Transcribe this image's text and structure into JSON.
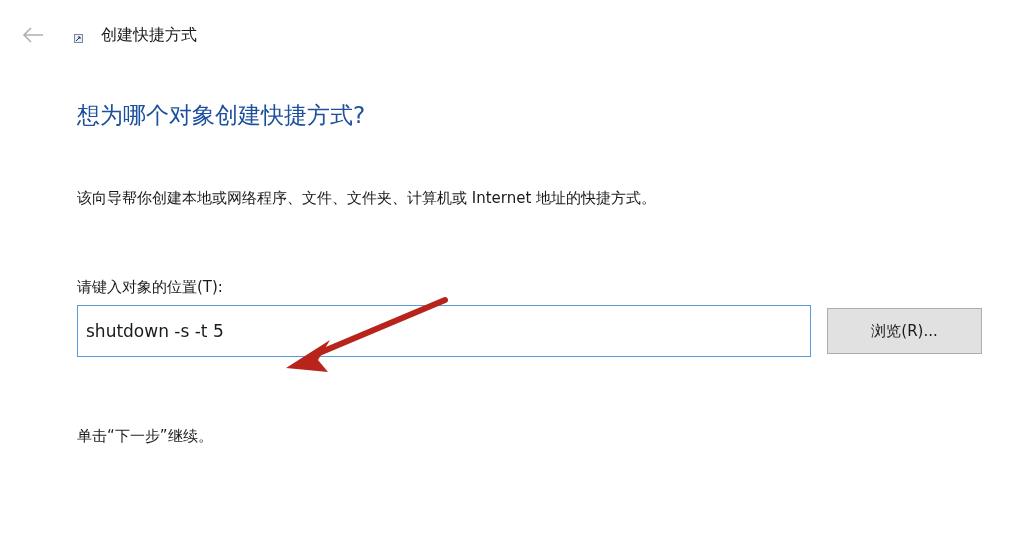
{
  "window": {
    "title": "创建快捷方式"
  },
  "heading": "想为哪个对象创建快捷方式?",
  "description": "该向导帮你创建本地或网络程序、文件、文件夹、计算机或 Internet 地址的快捷方式。",
  "location": {
    "label": "请键入对象的位置(T):",
    "value": "shutdown -s -t 5",
    "browse_button": "浏览(R)..."
  },
  "footer": "单击“下一步”继续。"
}
